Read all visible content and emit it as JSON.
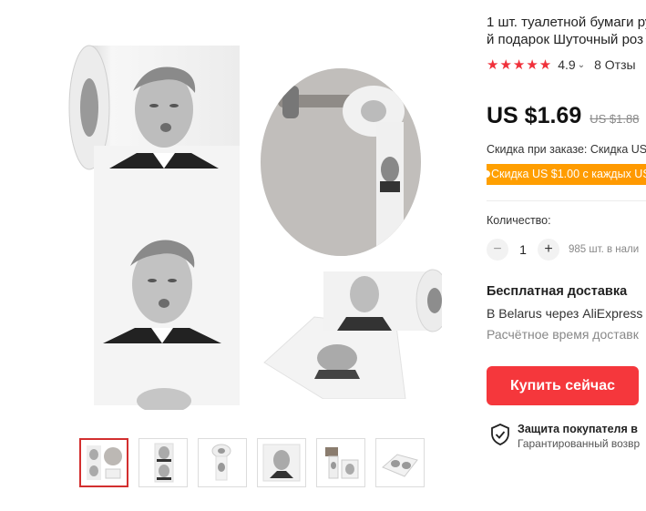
{
  "product": {
    "title_line1": "1 шт. туалетной бумаги ру",
    "title_line2": "й подарок Шуточный роз"
  },
  "rating": {
    "stars": "★★★★★",
    "value": "4.9",
    "chevron": "⌄",
    "reviews": "8 Отзы"
  },
  "price": {
    "current": "US $1.69",
    "old": "US $1.88"
  },
  "discount": {
    "text": "Скидка при заказе: Скидка US",
    "coupon": "Скидка US $1.00 с каждых US"
  },
  "quantity": {
    "label": "Количество:",
    "minus": "−",
    "value": "1",
    "plus": "+",
    "stock": "985 шт. в нали"
  },
  "shipping": {
    "title": "Бесплатная доставка",
    "route": "В Belarus через AliExpress",
    "time": "Расчётное время доставк"
  },
  "actions": {
    "buy_now": "Купить сейчас"
  },
  "protection": {
    "title": "Защита покупателя в",
    "subtitle": "Гарантированный возвр"
  },
  "gallery": {
    "thumbnails": [
      "thumb-1",
      "thumb-2",
      "thumb-3",
      "thumb-4",
      "thumb-5",
      "thumb-6"
    ],
    "active_index": 0
  },
  "colors": {
    "accent": "#f5373c",
    "star": "#f0303a",
    "coupon": "#ff9a00"
  }
}
